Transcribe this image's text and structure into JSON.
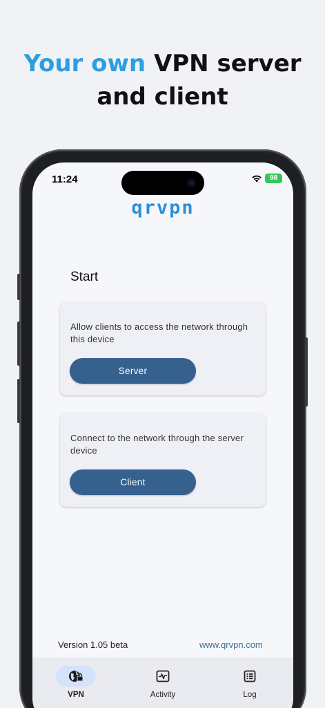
{
  "headline": {
    "accent": "Your own",
    "rest_line1": " VPN server",
    "line2": "and client"
  },
  "status_bar": {
    "time": "11:24",
    "battery": "98",
    "icons": [
      "wifi-icon",
      "battery-icon"
    ]
  },
  "app": {
    "logo": "qrvpn",
    "section_title": "Start",
    "cards": [
      {
        "description": "Allow clients to access the network through this device",
        "button_label": "Server"
      },
      {
        "description": "Connect to the network through the server device",
        "button_label": "Client"
      }
    ],
    "footer": {
      "version": "Version 1.05 beta",
      "url": "www.qrvpn.com"
    },
    "nav": [
      {
        "label": "VPN",
        "icon": "globe-lock-icon",
        "active": true
      },
      {
        "label": "Activity",
        "icon": "activity-icon",
        "active": false
      },
      {
        "label": "Log",
        "icon": "log-list-icon",
        "active": false
      }
    ]
  },
  "colors": {
    "accent_blue": "#2d9ee0",
    "button_blue": "#36618e",
    "nav_active_pill": "#d3e3fc",
    "battery_green": "#34c759"
  }
}
